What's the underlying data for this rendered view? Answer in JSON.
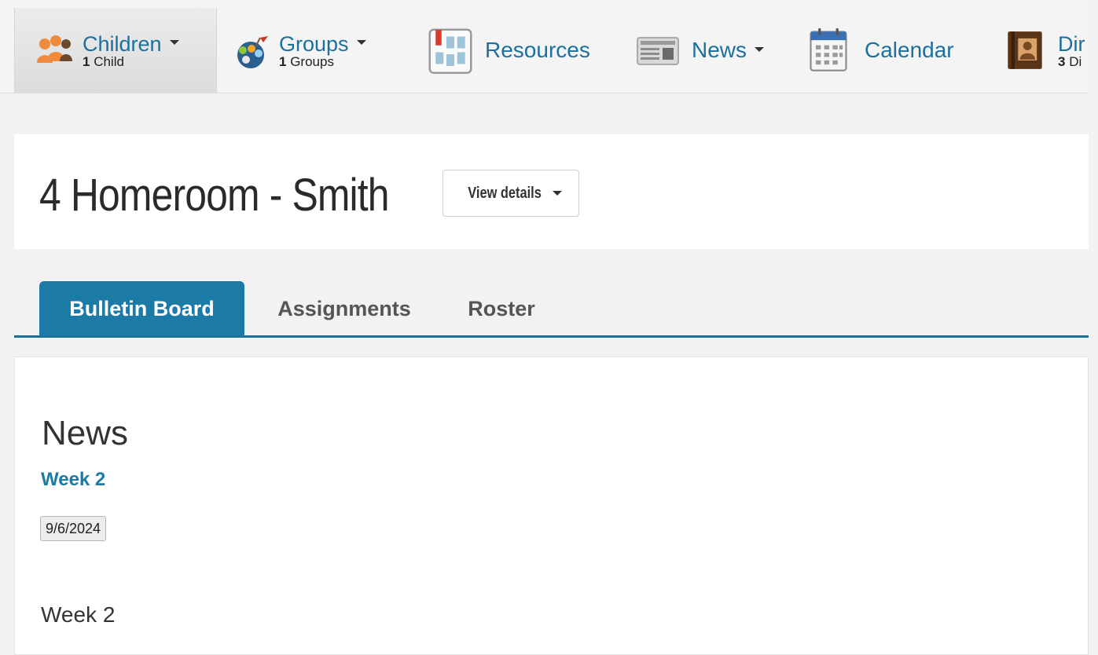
{
  "nav": {
    "children": {
      "label": "Children",
      "count": "1",
      "unit": "Child",
      "icon": "children-icon"
    },
    "groups": {
      "label": "Groups",
      "count": "1",
      "unit": "Groups",
      "icon": "groups-icon"
    },
    "resources": {
      "label": "Resources",
      "icon": "resources-icon"
    },
    "news": {
      "label": "News",
      "icon": "newspaper-icon"
    },
    "calendar": {
      "label": "Calendar",
      "icon": "calendar-icon"
    },
    "directory": {
      "label": "Dir",
      "count": "3",
      "unit": "Di",
      "icon": "directory-book-icon"
    }
  },
  "header": {
    "title": "4 Homeroom - Smith",
    "details_button": "View details"
  },
  "tabs": [
    {
      "label": "Bulletin Board",
      "active": true
    },
    {
      "label": "Assignments",
      "active": false
    },
    {
      "label": "Roster",
      "active": false
    }
  ],
  "news_section": {
    "title": "News",
    "item_title": "Week 2",
    "date": "9/6/2024",
    "body": "Week 2"
  },
  "colors": {
    "accent": "#1b7aa6",
    "link": "#1d6f9e",
    "background": "#f2f2f2"
  }
}
